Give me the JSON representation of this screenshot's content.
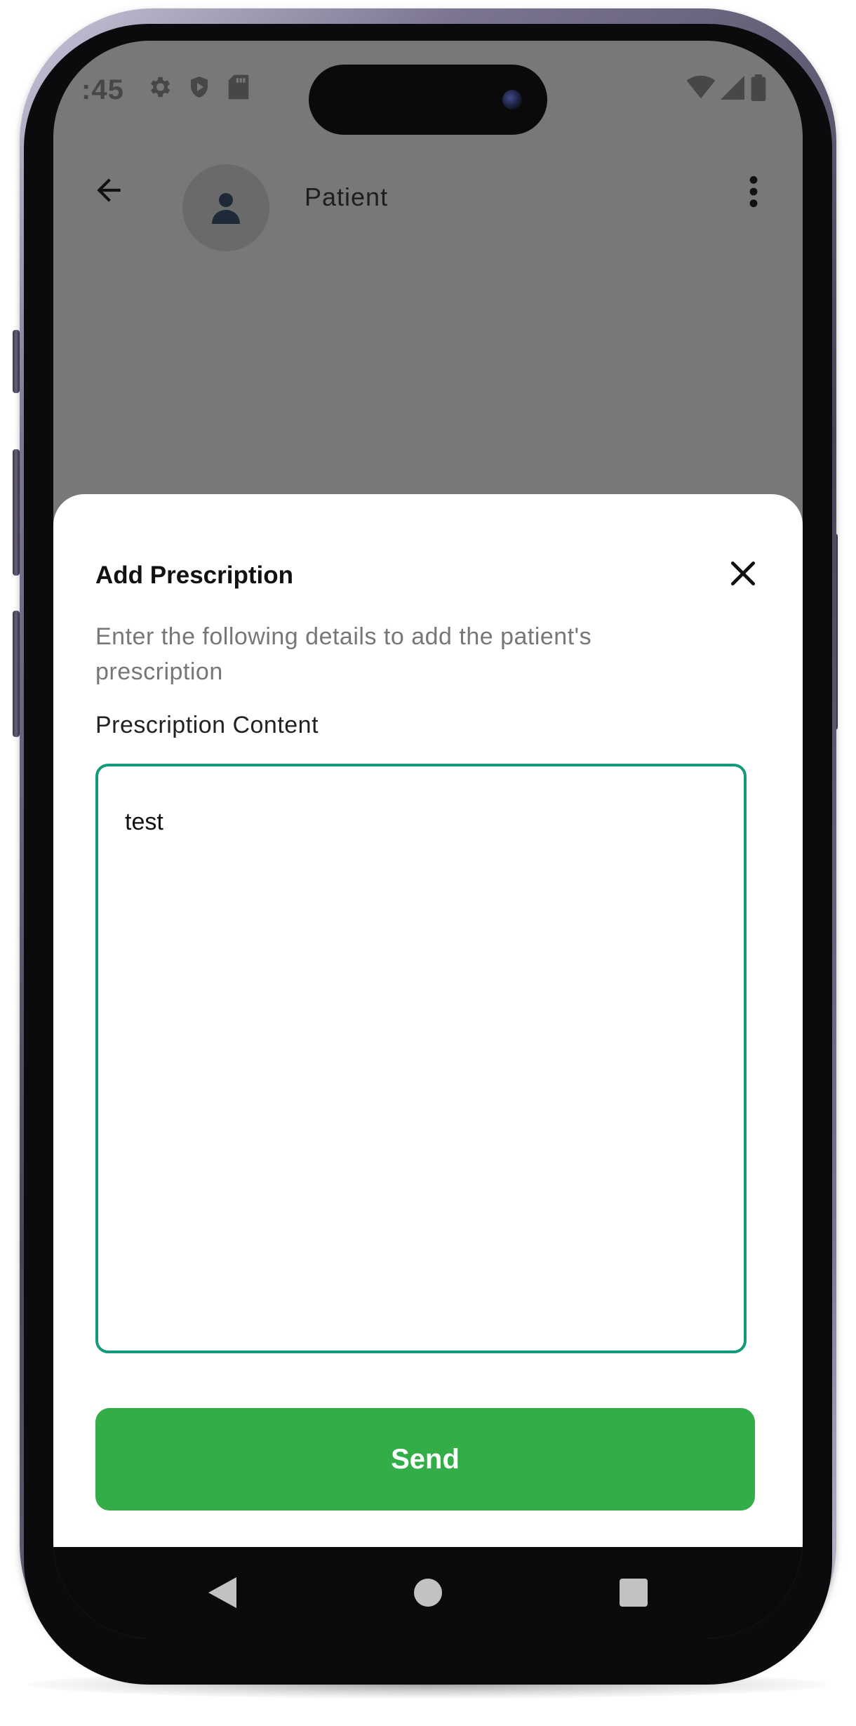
{
  "status_bar": {
    "time": ":45",
    "icons": [
      "gear-icon",
      "shield-play-icon",
      "sd-card-icon",
      "wifi-icon",
      "cell-signal-icon",
      "battery-icon"
    ]
  },
  "app_bar": {
    "title": "Patient",
    "back_icon": "arrow-left-icon",
    "avatar_icon": "person-icon",
    "more_icon": "more-vertical-icon"
  },
  "sheet": {
    "title": "Add Prescription",
    "description": "Enter the following details to add the patient's prescription",
    "field_label": "Prescription Content",
    "field_value": "test",
    "send_label": "Send",
    "close_icon": "close-icon"
  },
  "nav_bar": {
    "icons": [
      "back-triangle-icon",
      "home-circle-icon",
      "recents-square-icon"
    ]
  },
  "colors": {
    "scrim": "#787878",
    "sheet_background": "#ffffff",
    "field_border": "#129a7a",
    "send_button": "#33ad47",
    "frame": "#4a4459"
  }
}
